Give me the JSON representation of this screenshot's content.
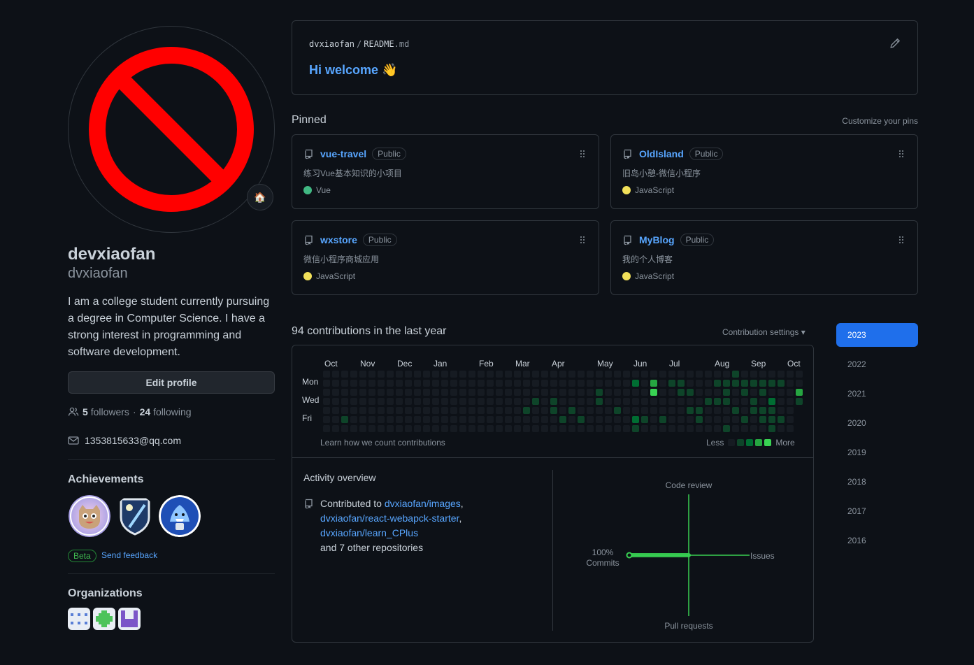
{
  "profile": {
    "name": "devxiaofan",
    "login": "dvxiaofan",
    "bio": "I am a college student currently pursuing a degree in Computer Science. I have a strong interest in programming and software development.",
    "status_emoji": "🏠",
    "edit_label": "Edit profile",
    "followers_count": "5",
    "followers_label": "followers",
    "sep": "·",
    "following_count": "24",
    "following_label": "following",
    "email": "1353815633@qq.com",
    "achievements_title": "Achievements",
    "beta_label": "Beta",
    "feedback_label": "Send feedback",
    "organizations_title": "Organizations"
  },
  "readme": {
    "owner": "dvxiaofan",
    "sep": "/",
    "file": "README",
    "ext": ".md",
    "title": "Hi welcome 👋"
  },
  "pinned": {
    "title": "Pinned",
    "customize": "Customize your pins",
    "items": [
      {
        "name": "vue-travel",
        "badge": "Public",
        "desc": "练习Vue基本知识的小项目",
        "lang": "Vue",
        "color": "#41b883"
      },
      {
        "name": "OldIsland",
        "badge": "Public",
        "desc": "旧岛小憩-微信小程序",
        "lang": "JavaScript",
        "color": "#f1e05a"
      },
      {
        "name": "wxstore",
        "badge": "Public",
        "desc": "微信小程序商城应用",
        "lang": "JavaScript",
        "color": "#f1e05a"
      },
      {
        "name": "MyBlog",
        "badge": "Public",
        "desc": "我的个人博客",
        "lang": "JavaScript",
        "color": "#f1e05a"
      }
    ]
  },
  "contributions": {
    "title": "94 contributions in the last year",
    "settings": "Contribution settings ▾",
    "months": [
      "Oct",
      "Nov",
      "Dec",
      "Jan",
      "Feb",
      "Mar",
      "Apr",
      "May",
      "Jun",
      "Jul",
      "Aug",
      "Sep",
      "Oct"
    ],
    "days": [
      "Mon",
      "Wed",
      "Fri"
    ],
    "learn": "Learn how we count contributions",
    "less": "Less",
    "more": "More",
    "levels": [
      "#161b22",
      "#0e4429",
      "#006d32",
      "#26a641",
      "#39d353"
    ]
  },
  "activity": {
    "title": "Activity overview",
    "prefix": "Contributed to",
    "repo1": "dvxiaofan/images",
    "comma1": ",",
    "repo2": "dvxiaofan/react-webapck-starter",
    "comma2": ",",
    "repo3": "dvxiaofan/learn_CPlus",
    "others": "and 7 other repositories",
    "code_review": "Code review",
    "issues": "Issues",
    "pull_requests": "Pull requests",
    "commits_pct": "100%",
    "commits": "Commits"
  },
  "years": [
    "2023",
    "2022",
    "2021",
    "2020",
    "2019",
    "2018",
    "2017",
    "2016"
  ]
}
